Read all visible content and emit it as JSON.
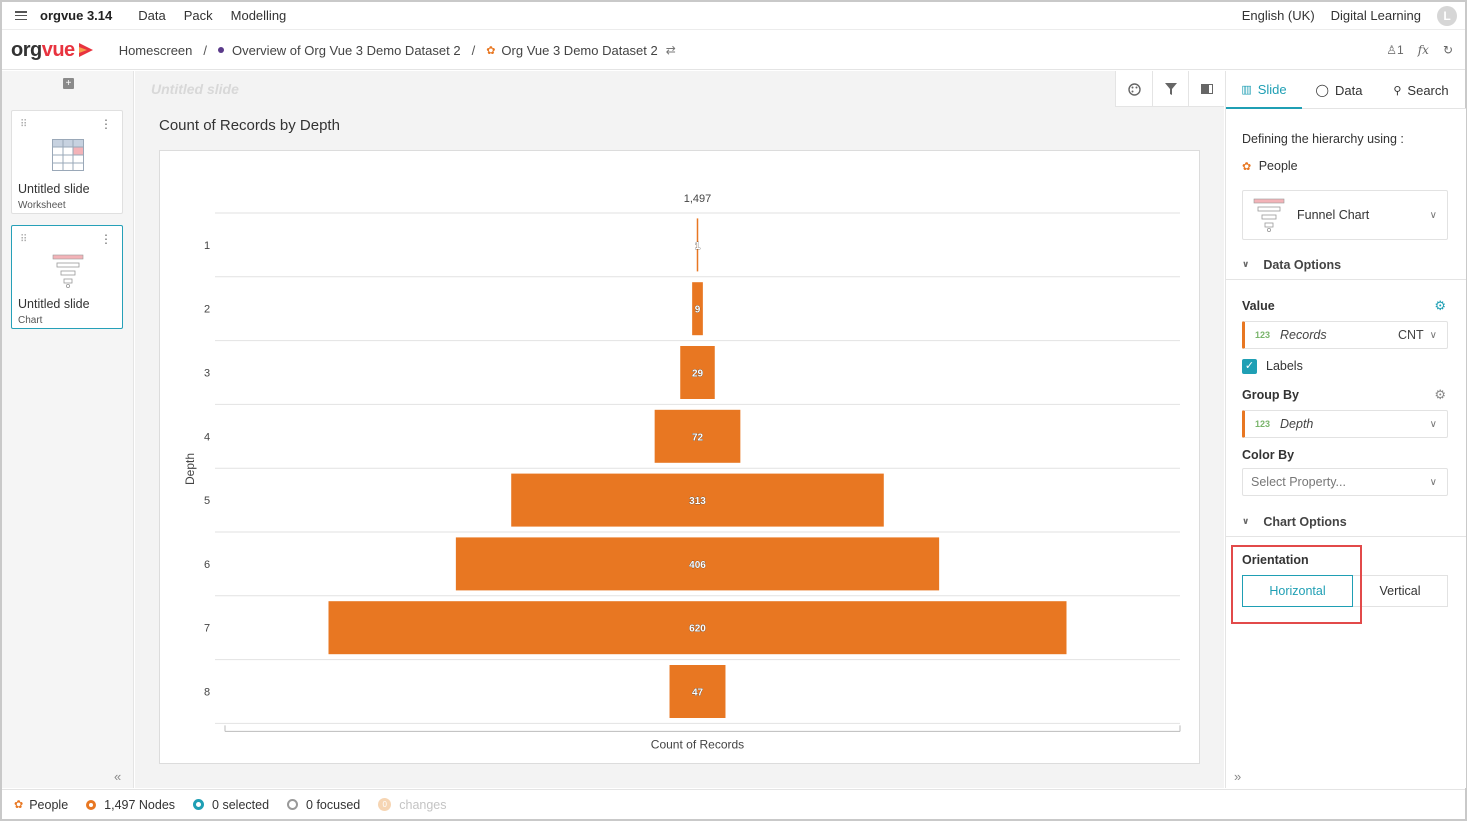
{
  "topbar": {
    "app_name": "orgvue 3.14",
    "menu": [
      "Data",
      "Pack",
      "Modelling"
    ],
    "language": "English (UK)",
    "workspace": "Digital Learning",
    "avatar_initial": "L"
  },
  "breadcrumb": {
    "logo": {
      "org": "org",
      "vue": "vue"
    },
    "items": [
      "Homescreen",
      "Overview of Org Vue 3 Demo Dataset 2",
      "Org Vue 3 Demo Dataset 2"
    ],
    "separator": "/",
    "user_count": "1",
    "fx_label": "fx"
  },
  "slides_panel": {
    "add_label": "+",
    "slides": [
      {
        "title": "Untitled slide",
        "type": "Worksheet"
      },
      {
        "title": "Untitled slide",
        "type": "Chart"
      }
    ]
  },
  "main": {
    "slide_title_placeholder": "Untitled slide",
    "chart_heading": "Count of Records by Depth"
  },
  "chart_data": {
    "type": "bar",
    "subtype": "funnel",
    "orientation": "horizontal",
    "title": "Count of Records by Depth",
    "xlabel": "Count of Records",
    "ylabel": "Depth",
    "total_label": "1,497",
    "categories": [
      "1",
      "2",
      "3",
      "4",
      "5",
      "6",
      "7",
      "8"
    ],
    "values": [
      1,
      9,
      29,
      72,
      313,
      406,
      620,
      47
    ],
    "color": "#e87722",
    "grid": true
  },
  "right_panel": {
    "tabs": [
      "Slide",
      "Data",
      "Search"
    ],
    "hierarchy_label": "Defining the hierarchy using :",
    "hierarchy_value": "People",
    "chart_type": "Funnel Chart",
    "data_options_label": "Data Options",
    "value_label": "Value",
    "value_field": {
      "badge": "123",
      "name": "Records",
      "agg": "CNT"
    },
    "labels_checkbox": "Labels",
    "group_by_label": "Group By",
    "group_by_field": {
      "badge": "123",
      "name": "Depth"
    },
    "color_by_label": "Color By",
    "color_by_placeholder": "Select Property...",
    "chart_options_label": "Chart Options",
    "orientation_label": "Orientation",
    "orientation_options": [
      "Horizontal",
      "Vertical"
    ],
    "orientation_selected": "Horizontal"
  },
  "statusbar": {
    "dataset": "People",
    "nodes": "1,497 Nodes",
    "selected": "0 selected",
    "focused": "0 focused",
    "changes": "changes",
    "changes_count": "0"
  },
  "colors": {
    "accent": "#1f9fb4",
    "brand_orange": "#e87722",
    "highlight": "#e24a4a"
  }
}
